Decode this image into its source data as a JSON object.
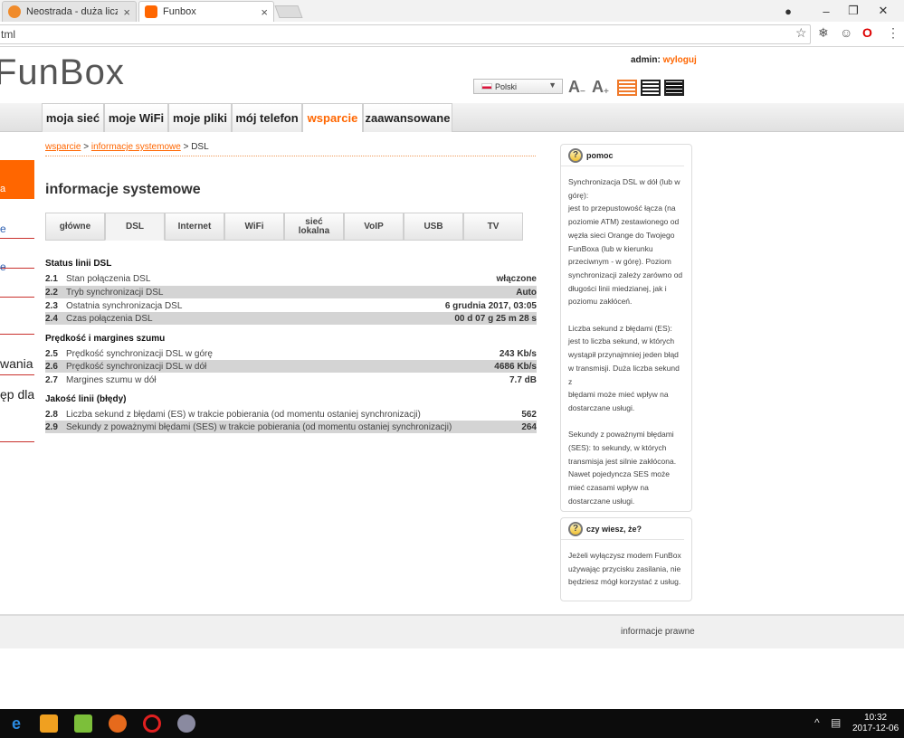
{
  "browser": {
    "tabs": [
      {
        "label": "Neostrada - duża liczba b"
      },
      {
        "label": "Funbox"
      }
    ],
    "url": "tml"
  },
  "header": {
    "logo": "FunBox",
    "admin_prefix": "admin:",
    "logout_label": "wyloguj",
    "language": "Polski",
    "font_dec_label": "A",
    "font_dec_mark": "−",
    "font_inc_label": "A",
    "font_inc_mark": "+"
  },
  "nav": {
    "items": [
      {
        "label": "moja sieć"
      },
      {
        "label": "moje WiFi"
      },
      {
        "label": "moje pliki"
      },
      {
        "label": "mój telefon"
      },
      {
        "label": "wsparcie"
      },
      {
        "label": "zaawansowane"
      }
    ]
  },
  "sidebar": {
    "items": [
      {
        "label": "a"
      },
      {
        "label": "e"
      },
      {
        "label": "e"
      },
      {
        "label": "wania"
      },
      {
        "label": "ęp dla"
      }
    ]
  },
  "breadcrumb": {
    "items": [
      "wsparcie",
      "informacje systemowe",
      "DSL"
    ],
    "separator": ">"
  },
  "page_title": "informacje systemowe",
  "subtabs": [
    {
      "label": "główne"
    },
    {
      "label": "DSL"
    },
    {
      "label": "Internet"
    },
    {
      "label": "WiFi"
    },
    {
      "label": "sieć lokalna"
    },
    {
      "label": "VoIP"
    },
    {
      "label": "USB"
    },
    {
      "label": "TV"
    }
  ],
  "sections": [
    {
      "title": "Status linii DSL",
      "rows": [
        {
          "num": "2.1",
          "label": "Stan połączenia DSL",
          "value": "włączone"
        },
        {
          "num": "2.2",
          "label": "Tryb synchronizacji DSL",
          "value": "Auto"
        },
        {
          "num": "2.3",
          "label": "Ostatnia synchronizacja DSL",
          "value": "6 grudnia 2017, 03:05"
        },
        {
          "num": "2.4",
          "label": "Czas połączenia DSL",
          "value": "00 d 07 g 25 m 28 s"
        }
      ]
    },
    {
      "title": "Prędkość i margines szumu",
      "rows": [
        {
          "num": "2.5",
          "label": "Prędkość synchronizacji DSL w górę",
          "value": "243 Kb/s"
        },
        {
          "num": "2.6",
          "label": "Prędkość synchronizacji DSL w dół",
          "value": "4686 Kb/s"
        },
        {
          "num": "2.7",
          "label": "Margines szumu w dół",
          "value": "7.7 dB"
        }
      ]
    },
    {
      "title": "Jakość linii (błędy)",
      "rows": [
        {
          "num": "2.8",
          "label": "Liczba sekund z błędami (ES) w trakcie pobierania (od momentu ostaniej synchronizacji)",
          "value": "562"
        },
        {
          "num": "2.9",
          "label": "Sekundy z poważnymi błędami (SES) w trakcie pobierania (od momentu ostaniej synchronizacji)",
          "value": "264"
        }
      ]
    }
  ],
  "help": {
    "title": "pomoc",
    "body": "Synchronizacja DSL w dół (lub w\ngórę):\njest to przepustowość łącza (na\npoziomie ATM) zestawionego od\nwęzła sieci Orange do Twojego\nFunBoxa (lub w kierunku\nprzeciwnym - w górę). Poziom\nsynchronizacji zależy zarówno od\ndługości linii miedzianej, jak i\npoziomu zakłóceń.\n\nLiczba sekund z błędami (ES):\njest to liczba sekund, w których\nwystąpił przynajmniej jeden błąd\nw transmisji. Duża liczba sekund z\nbłędami może mieć wpływ na\ndostarczane usługi.\n\nSekundy z poważnymi błędami\n(SES): to sekundy, w których\ntransmisja jest silnie zakłócona.\nNawet pojedyncza SES może\nmieć czasami wpływ na\ndostarczane usługi."
  },
  "tip": {
    "title": "czy wiesz, że?",
    "body": "Jeżeli wyłączysz modem FunBox\nużywając przycisku zasilania, nie\nbędziesz mógł korzystać z usług."
  },
  "footer": {
    "legal": "informacje prawne"
  },
  "taskbar": {
    "time": "10:32",
    "date": "2017-12-06"
  },
  "colors": {
    "accent": "#ff6600",
    "sidebar_line": "#c9302c",
    "row_alt": "#d4d4d4"
  }
}
